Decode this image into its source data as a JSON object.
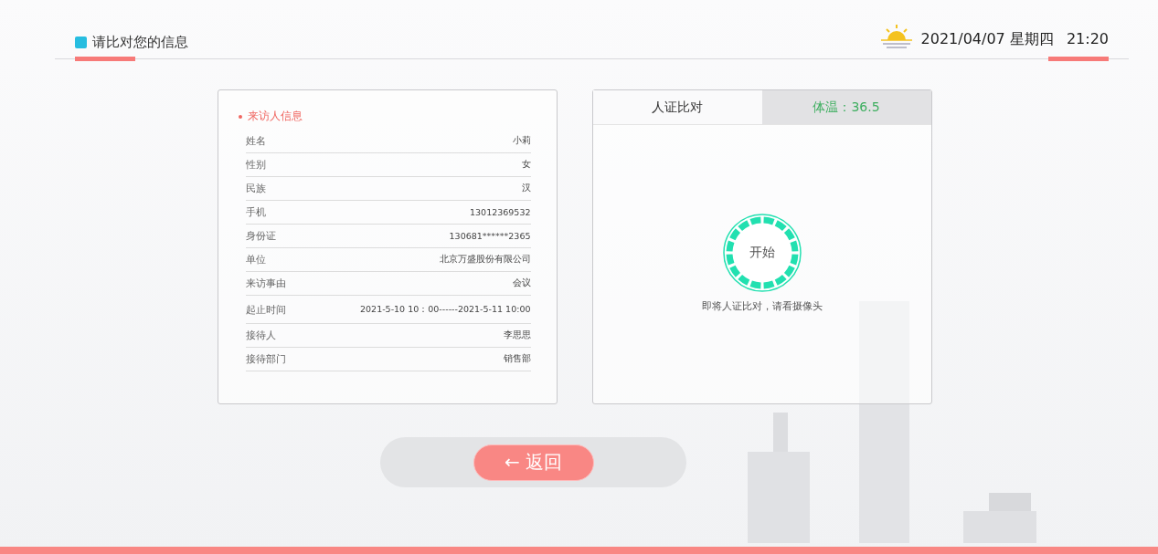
{
  "header": {
    "title": "请比对您的信息",
    "date": "2021/04/07 星期四",
    "time": "21:20"
  },
  "visitor": {
    "heading": "来访人信息",
    "rows": [
      {
        "label": "姓名",
        "value": "小莉"
      },
      {
        "label": "性别",
        "value": "女"
      },
      {
        "label": "民族",
        "value": "汉"
      },
      {
        "label": "手机",
        "value": "13012369532"
      },
      {
        "label": "身份证",
        "value": "130681******2365"
      },
      {
        "label": "单位",
        "value": "北京万盛股份有限公司"
      },
      {
        "label": "来访事由",
        "value": "会议"
      },
      {
        "label": "起止时间",
        "value": "2021-5-10 10：00------2021-5-11  10:00"
      },
      {
        "label": "接待人",
        "value": "李思思"
      },
      {
        "label": "接待部门",
        "value": "销售部"
      }
    ]
  },
  "compare": {
    "tabs": [
      {
        "label": "人证比对",
        "selected": true
      },
      {
        "label": "体温：36.5",
        "selected": false
      }
    ],
    "start_button": "开始",
    "hint": "即将人证比对，请看摄像头"
  },
  "back_button": "← 返回"
}
